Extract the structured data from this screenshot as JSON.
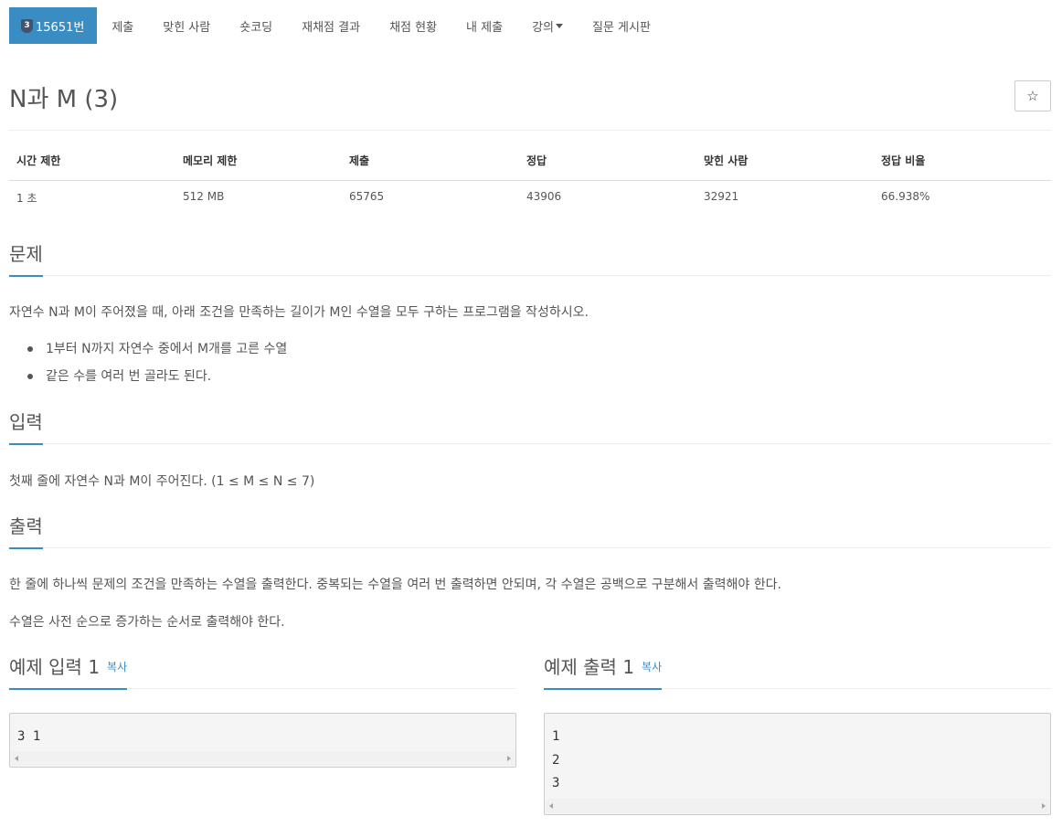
{
  "nav": {
    "problem_number": "15651번",
    "tier_badge": "3",
    "items": [
      "제출",
      "맞힌 사람",
      "숏코딩",
      "재채점 결과",
      "채점 현황",
      "내 제출",
      "강의",
      "질문 게시판"
    ]
  },
  "title": "N과 M (3)",
  "star": "☆",
  "info": {
    "headers": [
      "시간 제한",
      "메모리 제한",
      "제출",
      "정답",
      "맞힌 사람",
      "정답 비율"
    ],
    "values": [
      "1 초",
      "512 MB",
      "65765",
      "43906",
      "32921",
      "66.938%"
    ]
  },
  "problem": {
    "heading": "문제",
    "intro": "자연수 N과 M이 주어졌을 때, 아래 조건을 만족하는 길이가 M인 수열을 모두 구하는 프로그램을 작성하시오.",
    "conditions": [
      "1부터 N까지 자연수 중에서 M개를 고른 수열",
      "같은 수를 여러 번 골라도 된다."
    ]
  },
  "input": {
    "heading": "입력",
    "text": "첫째 줄에 자연수 N과 M이 주어진다. (1 ≤ M ≤ N ≤ 7)"
  },
  "output": {
    "heading": "출력",
    "text1": "한 줄에 하나씩 문제의 조건을 만족하는 수열을 출력한다. 중복되는 수열을 여러 번 출력하면 안되며, 각 수열은 공백으로 구분해서 출력해야 한다.",
    "text2": "수열은 사전 순으로 증가하는 순서로 출력해야 한다."
  },
  "samples": {
    "input_heading": "예제 입력 1",
    "output_heading": "예제 출력 1",
    "copy_label": "복사",
    "input_text": "3 1",
    "output_text": "1\n2\n3"
  },
  "colors": {
    "accent": "#3a8dc3",
    "text": "#555555",
    "badge": "#44526b",
    "code_bg": "#f5f5f5"
  }
}
